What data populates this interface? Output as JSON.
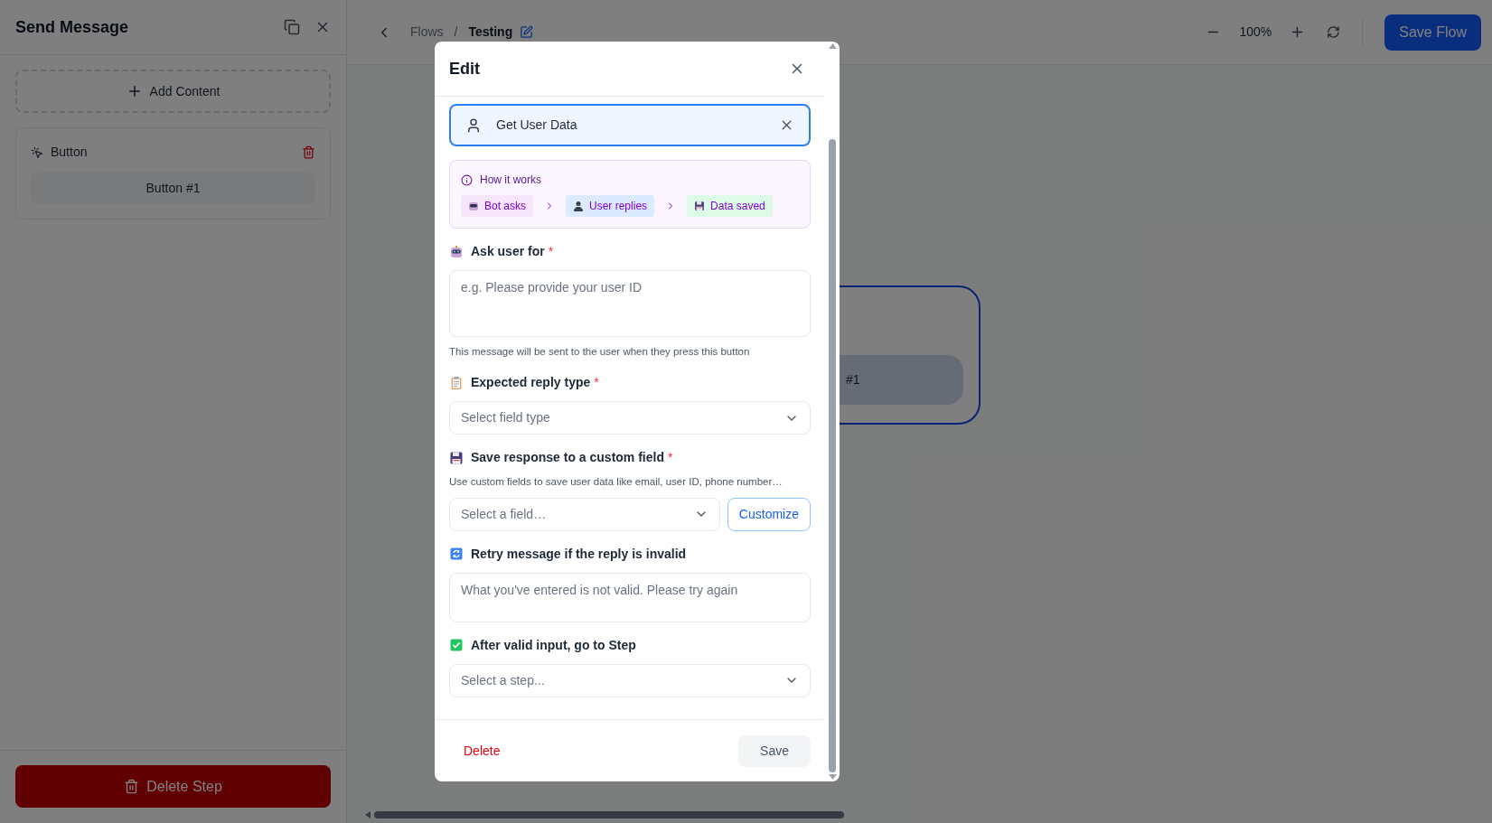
{
  "sidebar": {
    "title": "Send Message",
    "add_content": "Add Content",
    "blocks": [
      {
        "kind": "button",
        "label": "Button",
        "buttons": [
          "Button #1"
        ]
      }
    ],
    "delete_step": "Delete Step"
  },
  "header": {
    "breadcrumb": [
      "Flows",
      "Testing"
    ],
    "separator": "/",
    "zoom": "100%",
    "save": "Save Flow"
  },
  "canvas": {
    "node": {
      "button_text": "#1"
    }
  },
  "modal": {
    "title": "Edit",
    "action": {
      "label": "Get User Data"
    },
    "info": {
      "title": "How it works",
      "steps": [
        {
          "label": "Bot asks",
          "color": "#f7e6fb"
        },
        {
          "label": "User replies",
          "color": "#dbeafe"
        },
        {
          "label": "Data saved",
          "color": "#dcfce7"
        }
      ]
    },
    "fields": [
      {
        "kind": "textarea",
        "label": "Ask user for",
        "required_mark": "*",
        "placeholder": "e.g. Please provide your user ID",
        "help": "This message will be sent to the user when they press this button"
      },
      {
        "kind": "select",
        "label": "Expected reply type",
        "required_mark": "*",
        "placeholder": "Select field type"
      },
      {
        "kind": "select_button",
        "label": "Save response to a custom field",
        "required_mark": "*",
        "description": "Use custom fields to save user data like email, user ID, phone number…",
        "placeholder": "Select a field…",
        "button": "Customize"
      },
      {
        "kind": "textarea",
        "label": "Retry message if the reply is invalid",
        "placeholder": "What you've entered is not valid. Please try again"
      },
      {
        "kind": "select",
        "label": "After valid input, go to Step",
        "placeholder": "Select a step..."
      }
    ],
    "footer": {
      "delete": "Delete",
      "save": "Save"
    }
  }
}
